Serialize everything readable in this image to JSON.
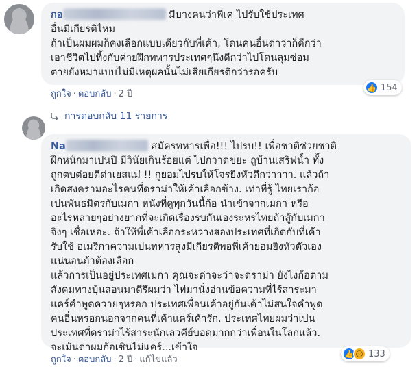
{
  "comment1": {
    "author_visible": "กอ",
    "author_tail": "",
    "text_line1": "มีบางคนว่าพี่เค ไปรับใช้ประเทศ",
    "body": "อื่นมีเกียรติไหม\nถ้าเป็นผมผมก็คงเลือกแบบเดียวกับพี่เค้า, โดนคนอื่นด่าว่าก็ดีกว่า\nเอาชีวิตไปทิ้งกับค่ายฝึกทหารประเทศๆนึงดีกว่าไปโดนลุมซ่อม\nตายยังหมาแบบไม่มีเหตุผลนั้นไม่เสียเกียรติกว่ารอครับ",
    "like_label": "ถูกใจ",
    "reply_label": "ตอบกลับ",
    "time": "2 ปี",
    "reaction_count": "154"
  },
  "replies_toggle": {
    "label": "การตอบกลับ 11 รายการ"
  },
  "comment2": {
    "author_visible": "Na",
    "text_line1": "สมัครทหารเพื่อ!!! ไปรบ!! เพื่อชาติช่วยชาติ",
    "body": "ฝึกหนักมาเปนปี มีวินัยเกินร้อยแต่ ไปกวาดขยะ ถูบ้านเสริฟน้ำ ทั้ง\nถูกตบต่อยตีด่าเยสแม่ !! กูยอมไปรบให้โจรยิงหัวดีกว่าาาา. แล้วถ้า\nเกิดสงครามอะไรคนที่ดราม่าให้เค้าเลือกข้าง. เท่าที่รู้ ไทยเราก้อ\nเปนพันธมิตรกับเมกา หนังที่ดูทุกวันนี้ก้อ นำเข้าจากเมกา หรือ\nอะไรหลายๆอย่างยากที่จะเกิดเรื่องรบกันเองระหรไทยถ้าสู้กับเมกา\nจิงๆ เชื่อเหอะ. ถ้าให้พี่เค้าเลือกระหว่างสองประเทศที่เกิดกับที่เค้า\nรับใช้ อเมริกาความเปนทหารสูงมีเกียรติพอพี่เค้ายอมยิงหัวตัวเอง\nแน่นอนถ้าต้องเลือก\nแล้วการเป็นอยู่ประเทศเมกา คุณจะด่าจะว่าจะดราม่า ยังไงก้อตาม\nสังคมทางบุ้นสอนมาดีรึผมว่า ไท่มานั่งอ่านข้อความที่ไร้สาระมา\nแคร์คำพูดควายๆหรอก ประเทศเพื่อนเค้าอยู่กันเค้าไม่สนใจคำพูด\nคนอื่นหรอกนอกจากคนที่เค้าแคร์เค้ารัก. ประเทศไทยผมว่าเปน\nประเทศที่ดราม่าไร้สาระนักเลวคีย์บอดมากกว่าเพื่อนในโลกแล้ว.\nจะเม้นด่าผมก้อเชินไม่แคร์...เข้าใจ",
    "like_label": "ถูกใจ",
    "reply_label": "ตอบกลับ",
    "time": "2 ปี",
    "edited_label": "แก้ไขแล้ว",
    "reaction_count": "133"
  },
  "icons": {
    "like": "like-icon",
    "sad": "sad-icon"
  },
  "colors": {
    "link": "#385898",
    "bubble": "#f2f3f5",
    "like_blue": "#1877f2"
  }
}
